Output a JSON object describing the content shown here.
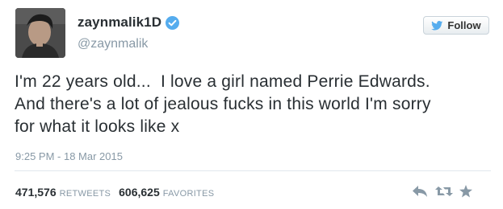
{
  "user": {
    "full_name": "zaynmalik1D",
    "screen_name": "@zaynmalik",
    "verified": true
  },
  "follow_button": {
    "label": "Follow"
  },
  "tweet": {
    "text": "I'm 22 years old...  I love a girl named Perrie Edwards.\nAnd there's a lot of jealous fucks in this world I'm sorry\nfor what it looks like x",
    "timestamp": "9:25 PM - 18 Mar 2015"
  },
  "stats": {
    "retweets_count": "471,576",
    "retweets_label": "RETWEETS",
    "favorites_count": "606,625",
    "favorites_label": "FAVORITES"
  },
  "icons": {
    "reply": "reply-icon",
    "retweet": "retweet-icon",
    "favorite": "favorite-icon",
    "verified": "verified-badge-icon",
    "twitter_bird": "twitter-bird-icon"
  },
  "colors": {
    "text": "#292f33",
    "muted": "#8899a6",
    "verified_blue": "#55acee",
    "action_gray": "#8899a6"
  }
}
